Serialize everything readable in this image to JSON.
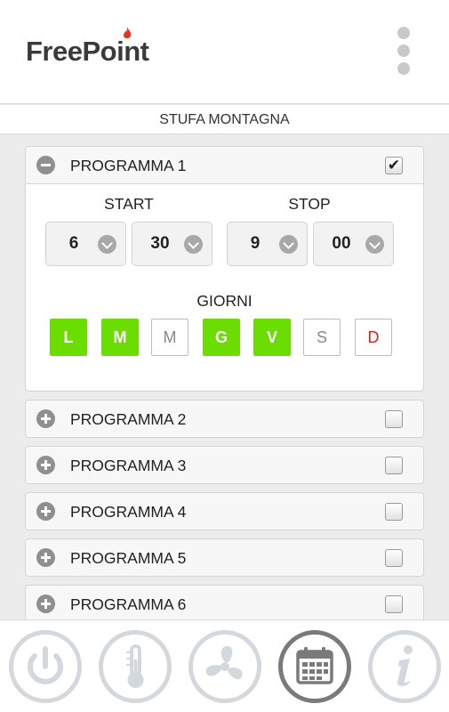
{
  "header": {
    "logo_text": "FreePoint",
    "menu_icon": "kebab-menu-icon"
  },
  "device": {
    "name": "STUFA MONTAGNA"
  },
  "programs": [
    {
      "title": "PROGRAMMA 1",
      "expanded": true,
      "checked": true,
      "start_label": "START",
      "stop_label": "STOP",
      "start_hour": "6",
      "start_minute": "30",
      "stop_hour": "9",
      "stop_minute": "00",
      "days_label": "GIORNI",
      "days": [
        {
          "label": "L",
          "active": true
        },
        {
          "label": "M",
          "active": true
        },
        {
          "label": "M",
          "active": false
        },
        {
          "label": "G",
          "active": true
        },
        {
          "label": "V",
          "active": true
        },
        {
          "label": "S",
          "active": false
        },
        {
          "label": "D",
          "active": false
        }
      ]
    },
    {
      "title": "PROGRAMMA 2",
      "expanded": false,
      "checked": false
    },
    {
      "title": "PROGRAMMA 3",
      "expanded": false,
      "checked": false
    },
    {
      "title": "PROGRAMMA 4",
      "expanded": false,
      "checked": false
    },
    {
      "title": "PROGRAMMA 5",
      "expanded": false,
      "checked": false
    },
    {
      "title": "PROGRAMMA 6",
      "expanded": false,
      "checked": false
    }
  ],
  "nav": [
    {
      "icon": "power-icon",
      "active": false
    },
    {
      "icon": "thermometer-icon",
      "active": false
    },
    {
      "icon": "fan-icon",
      "active": false
    },
    {
      "icon": "calendar-icon",
      "active": true
    },
    {
      "icon": "info-icon",
      "active": false
    }
  ],
  "colors": {
    "day_active": "#6bdd00",
    "sunday_text": "#e02020",
    "flame": "#e8361c",
    "nav_active_ring": "#7a7a7a",
    "nav_ring": "#d3d8dc"
  }
}
